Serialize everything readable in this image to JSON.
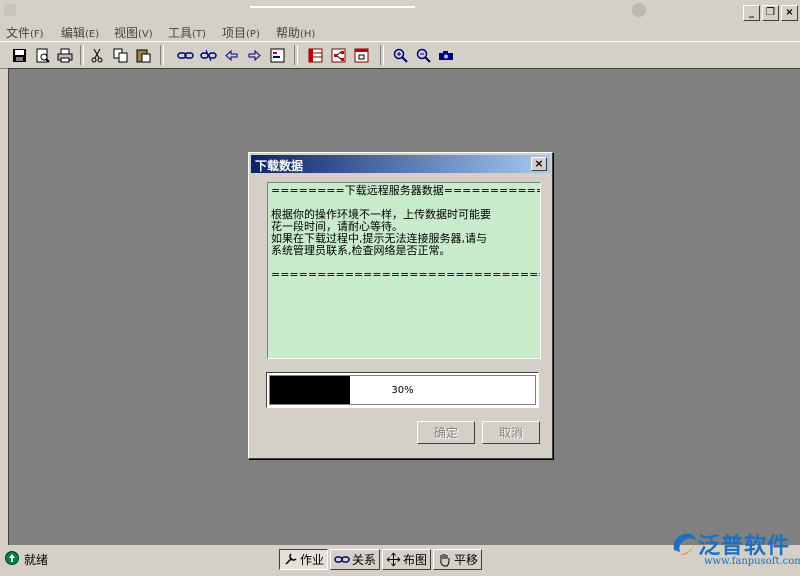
{
  "menu": [
    {
      "label": "文件",
      "accel": "(F)"
    },
    {
      "label": "编辑",
      "accel": "(E)"
    },
    {
      "label": "视图",
      "accel": "(V)"
    },
    {
      "label": "工具",
      "accel": "(T)"
    },
    {
      "label": "项目",
      "accel": "(P)"
    },
    {
      "label": "帮助",
      "accel": "(H)"
    }
  ],
  "window_buttons": {
    "minimize": "_",
    "restore": "❐",
    "close": "×"
  },
  "dialog": {
    "title": "下载数据",
    "close": "×",
    "message_lines": [
      "========下载远程服务器数据================",
      "",
      "      根据你的操作环境不一样，上传数据时可能要",
      "花一段时间，请耐心等待。",
      "    如果在下载过程中,提示无法连接服务器,请与",
      "系统管理员联系,检查网络是否正常。",
      "",
      "=========================================="
    ],
    "progress": {
      "value": 0.3,
      "text": "30%"
    },
    "ok_label": "确定",
    "cancel_label": "取消"
  },
  "status": {
    "text": "就绪"
  },
  "modes": [
    {
      "label": "作业",
      "icon": "wrench-icon",
      "active": true
    },
    {
      "label": "关系",
      "icon": "link-icon",
      "active": false
    },
    {
      "label": "布图",
      "icon": "move-arrows-icon",
      "active": false
    },
    {
      "label": "平移",
      "icon": "hand-icon",
      "active": false
    }
  ],
  "logo": {
    "name": "泛普软件",
    "url": "www.fanpusoft.com"
  },
  "colors": {
    "message_bg": "#c8ebcc",
    "workspace": "#808080",
    "title_gradient_start": "#0a246a"
  }
}
